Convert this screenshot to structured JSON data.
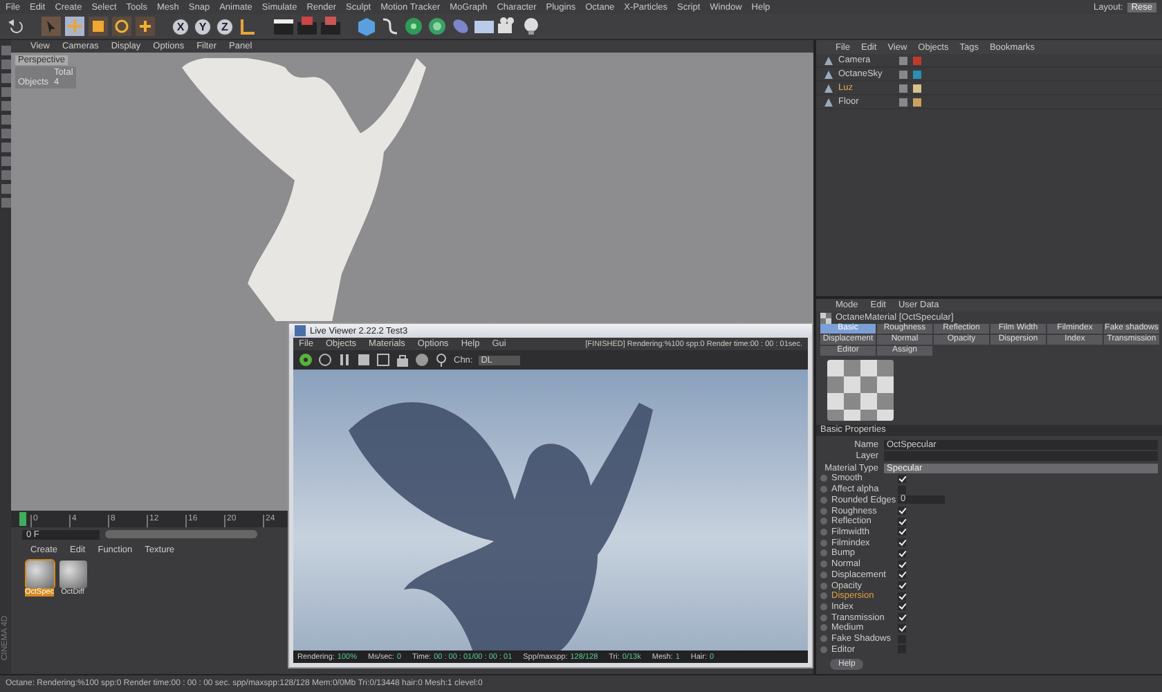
{
  "menubar": {
    "items": [
      "File",
      "Edit",
      "Create",
      "Select",
      "Tools",
      "Mesh",
      "Snap",
      "Animate",
      "Simulate",
      "Render",
      "Sculpt",
      "Motion Tracker",
      "MoGraph",
      "Character",
      "Plugins",
      "Octane",
      "X-Particles",
      "Script",
      "Window",
      "Help"
    ],
    "layout_label": "Layout:",
    "layout_value": "Rese"
  },
  "toolbar": {
    "axis_buttons": [
      "X",
      "Y",
      "Z"
    ]
  },
  "viewport": {
    "menu": [
      "View",
      "Cameras",
      "Display",
      "Options",
      "Filter",
      "Panel"
    ],
    "camera": "Perspective",
    "stats_label": "Total",
    "objects_label": "Objects",
    "objects_value": "4"
  },
  "timeline": {
    "ticks": [
      "0",
      "4",
      "8",
      "12",
      "16",
      "20",
      "24"
    ],
    "frame": "0 F"
  },
  "material_manager": {
    "menu": [
      "Create",
      "Edit",
      "Function",
      "Texture"
    ],
    "materials": [
      {
        "name": "OctSpec",
        "selected": true
      },
      {
        "name": "OctDiff",
        "selected": false
      }
    ]
  },
  "brand": "CINEMA 4D",
  "object_manager": {
    "menu": [
      "File",
      "Edit",
      "View",
      "Objects",
      "Tags",
      "Bookmarks"
    ],
    "objects": [
      {
        "name": "Camera",
        "selected": false
      },
      {
        "name": "OctaneSky",
        "selected": false
      },
      {
        "name": "Luz",
        "selected": true
      },
      {
        "name": "Floor",
        "selected": false
      }
    ]
  },
  "attributes": {
    "menu": [
      "Mode",
      "Edit",
      "User Data"
    ],
    "title": "OctaneMaterial [OctSpecular]",
    "tabs": [
      {
        "label": "Basic",
        "selected": true
      },
      {
        "label": "Roughness",
        "selected": false
      },
      {
        "label": "Reflection",
        "selected": false
      },
      {
        "label": "Film Width",
        "selected": false
      },
      {
        "label": "Filmindex",
        "selected": false
      },
      {
        "label": "Fake shadows",
        "selected": false
      },
      {
        "label": "Displacement",
        "selected": false
      },
      {
        "label": "Normal",
        "selected": false
      },
      {
        "label": "Opacity",
        "selected": false
      },
      {
        "label": "Dispersion",
        "selected": false
      },
      {
        "label": "Index",
        "selected": false
      },
      {
        "label": "Transmission",
        "selected": false
      },
      {
        "label": "Editor",
        "selected": false
      },
      {
        "label": "Assign",
        "selected": false
      }
    ],
    "section": "Basic Properties",
    "fields": [
      {
        "label": "Name",
        "kind": "text",
        "value": "OctSpecular"
      },
      {
        "label": "Layer",
        "kind": "text"
      },
      {
        "label": "Material Type",
        "kind": "dropdown",
        "value": "Specular"
      }
    ],
    "options": [
      {
        "label": "Smooth",
        "kind": "check",
        "checked": true,
        "highlighted": false
      },
      {
        "label": "Affect alpha",
        "kind": "check",
        "checked": false,
        "highlighted": false
      },
      {
        "label": "Rounded Edges",
        "kind": "number",
        "value": "0",
        "highlighted": false
      },
      {
        "label": "Roughness",
        "kind": "check",
        "checked": true,
        "highlighted": false
      },
      {
        "label": "Reflection",
        "kind": "check",
        "checked": true,
        "highlighted": false
      },
      {
        "label": "Filmwidth",
        "kind": "check",
        "checked": true,
        "highlighted": false
      },
      {
        "label": "Filmindex",
        "kind": "check",
        "checked": true,
        "highlighted": false
      },
      {
        "label": "Bump",
        "kind": "check",
        "checked": true,
        "highlighted": false
      },
      {
        "label": "Normal",
        "kind": "check",
        "checked": true,
        "highlighted": false
      },
      {
        "label": "Displacement",
        "kind": "check",
        "checked": true,
        "highlighted": false
      },
      {
        "label": "Opacity",
        "kind": "check",
        "checked": true,
        "highlighted": false
      },
      {
        "label": "Dispersion",
        "kind": "check",
        "checked": true,
        "highlighted": true
      },
      {
        "label": "Index",
        "kind": "check",
        "checked": true,
        "highlighted": false
      },
      {
        "label": "Transmission",
        "kind": "check",
        "checked": true,
        "highlighted": false
      },
      {
        "label": "Medium",
        "kind": "check",
        "checked": true,
        "highlighted": false
      },
      {
        "label": "Fake Shadows",
        "kind": "check",
        "checked": false,
        "highlighted": false
      },
      {
        "label": "Editor",
        "kind": "check",
        "checked": false,
        "highlighted": false
      }
    ],
    "help": "Help"
  },
  "live_viewer": {
    "title": "Live Viewer 2.22.2 Test3",
    "menu": [
      "File",
      "Objects",
      "Materials",
      "Options",
      "Help",
      "Gui"
    ],
    "status": "[FINISHED] Rendering:%100 spp:0 Render time:00 : 00 : 01sec.",
    "channel_label": "Chn:",
    "channel_value": "DL",
    "stats": [
      {
        "label": "Rendering:",
        "value": "100%"
      },
      {
        "label": "Ms/sec:",
        "value": "0"
      },
      {
        "label": "Time:",
        "value": "00 : 00 : 01/00 : 00 : 01"
      },
      {
        "label": "Spp/maxspp:",
        "value": "128/128"
      },
      {
        "label": "Tri:",
        "value": "0/13k"
      },
      {
        "label": "Mesh:",
        "value": "1"
      },
      {
        "label": "Hair:",
        "value": "0"
      }
    ]
  },
  "status_bar": "Octane: Rendering:%100 spp:0 Render time:00 : 00 : 00 sec. spp/maxspp:128/128 Mem:0/0Mb Tri:0/13448 hair:0 Mesh:1 clevel:0"
}
